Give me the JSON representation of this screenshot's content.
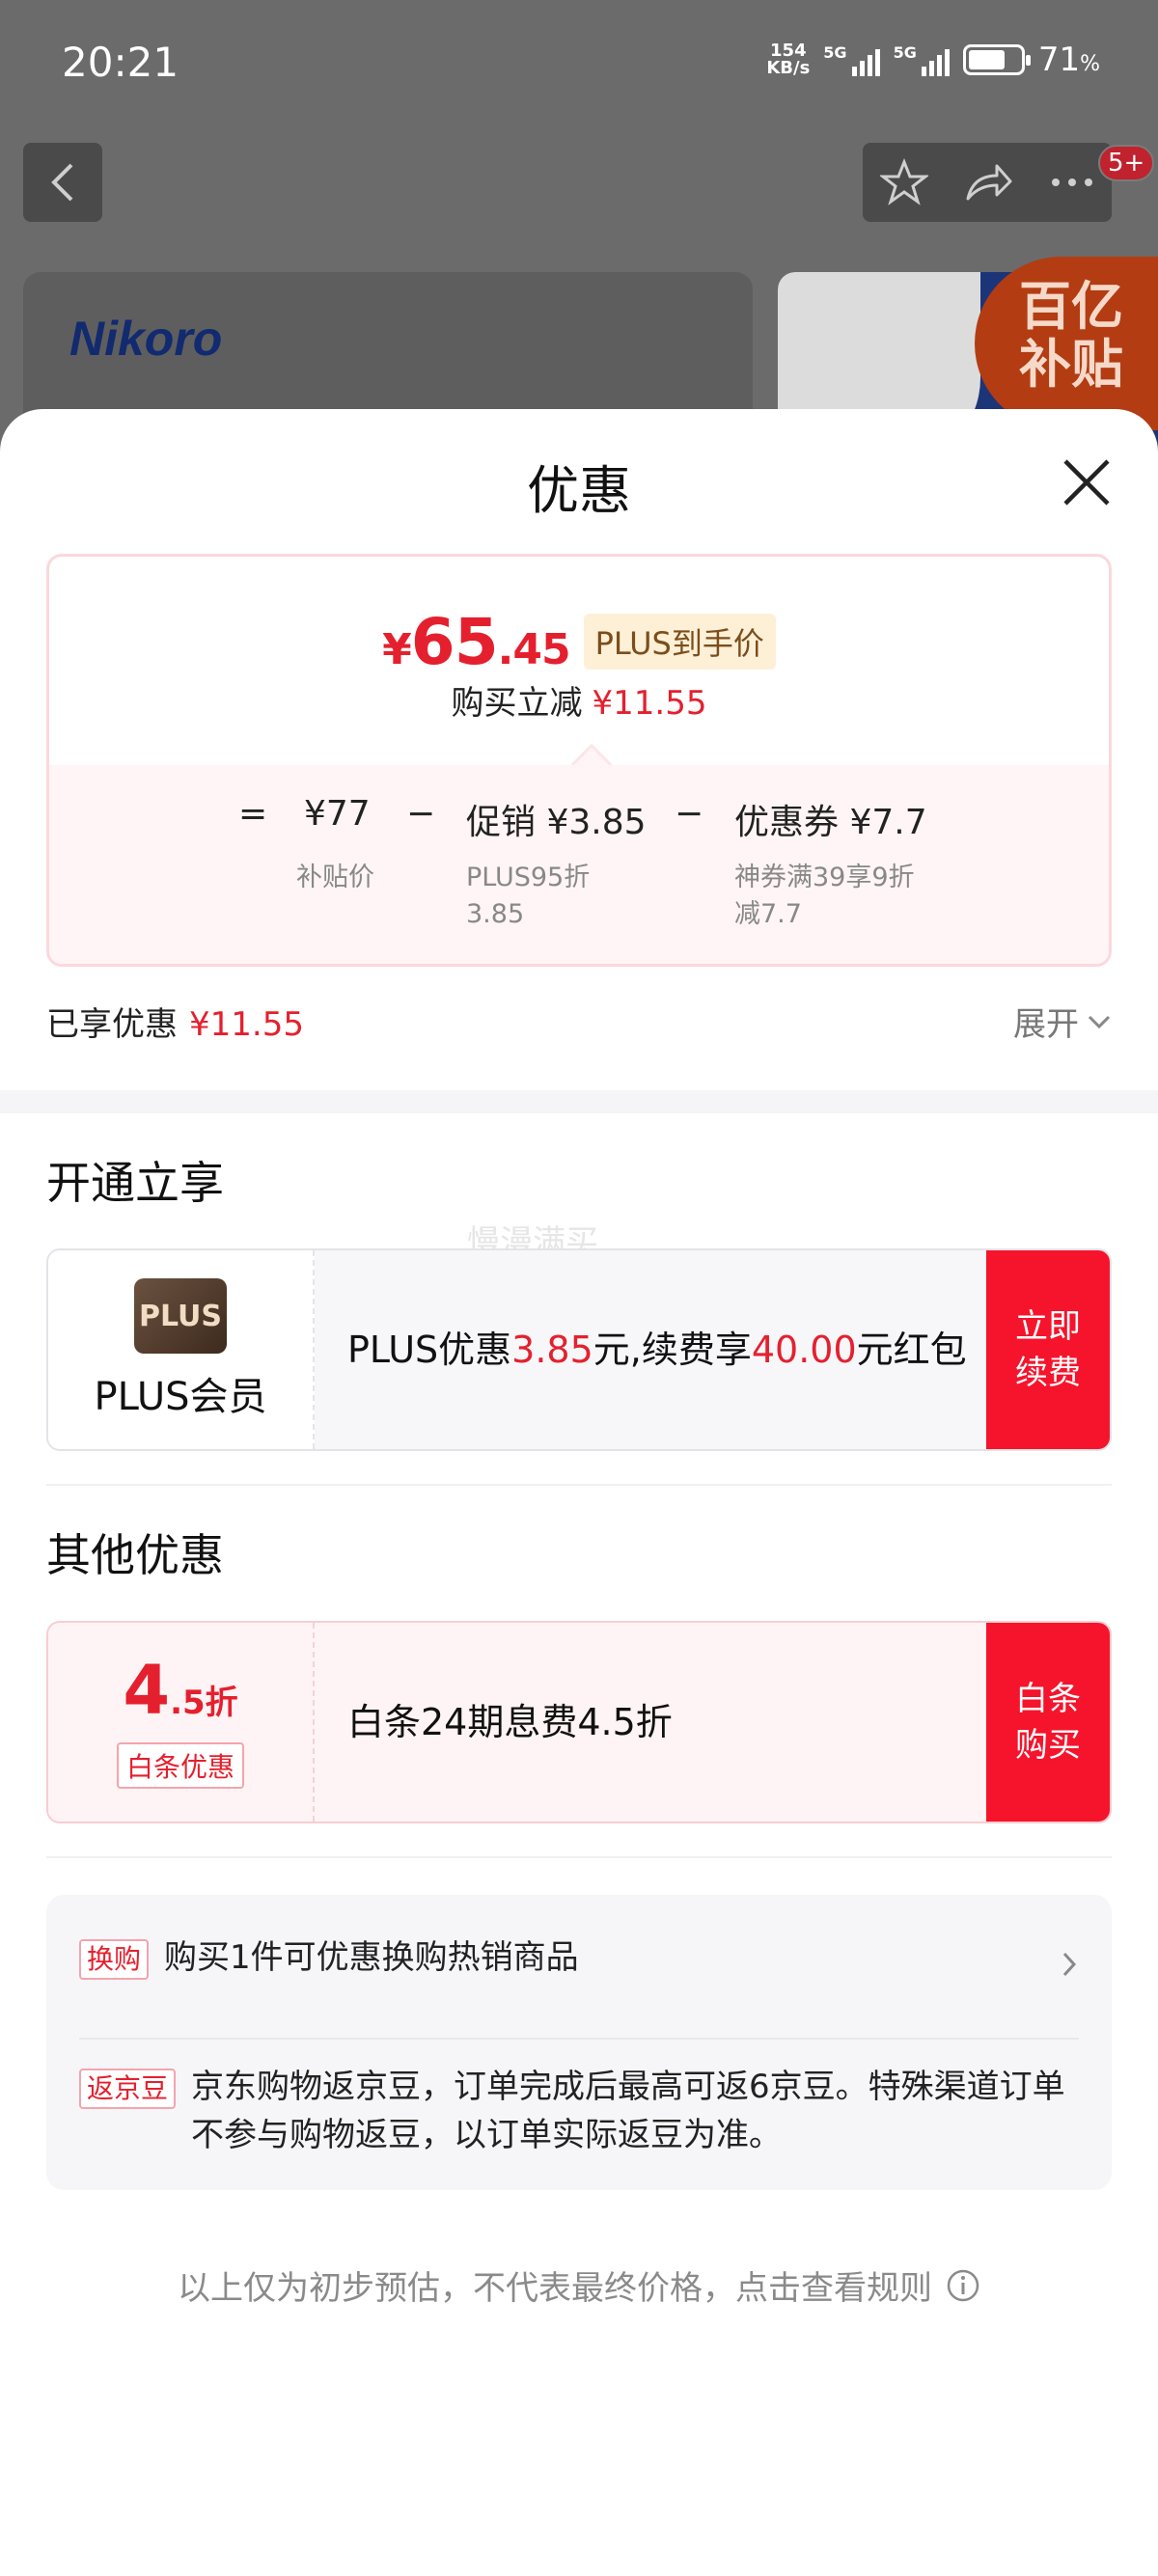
{
  "status_bar": {
    "time": "20:21",
    "net_speed_value": "154",
    "net_speed_unit": "KB/s",
    "sim1_label": "5G",
    "sim2_label": "5G",
    "battery_percent": "71",
    "battery_unit": "%",
    "battery_level": 0.71
  },
  "background": {
    "notification_badge": "5+",
    "brand_logo": "Nikoro",
    "subsidy_badge_line1": "百亿",
    "subsidy_badge_line2": "补贴"
  },
  "sheet": {
    "title": "优惠",
    "price_summary": {
      "yen": "¥",
      "price_int": "65",
      "price_dec": ".45",
      "price_tag": "PLUS到手价",
      "reduce_label": "购买立减",
      "reduce_amount": "¥11.55"
    },
    "breakdown": {
      "equals": "=",
      "minus": "−",
      "base_price": "¥77",
      "base_label": "补贴价",
      "promo_label": "促销",
      "promo_amount": "¥3.85",
      "promo_detail_line1": "PLUS95折",
      "promo_detail_line2": "3.85",
      "coupon_label": "优惠券",
      "coupon_amount": "¥7.7",
      "coupon_detail_line1": "神券满39享9折",
      "coupon_detail_line2": "减7.7"
    },
    "enjoyed": {
      "label": "已享优惠",
      "amount": "¥11.55",
      "expand_label": "展开"
    },
    "open_section": {
      "title": "开通立享",
      "watermark": "慢漫满买",
      "plus_logo_text": "PLUS",
      "plus_name": "PLUS会员",
      "text_prefix": "PLUS优惠",
      "amount1": "3.85",
      "text_middle": "元,续费享",
      "amount2": "40.00",
      "text_suffix": "元红包",
      "cta_line1": "立即",
      "cta_line2": "续费"
    },
    "other_section": {
      "title": "其他优惠",
      "discount_big": "4",
      "discount_small": ".5折",
      "discount_tag": "白条优惠",
      "text": "白条24期息费4.5折",
      "cta_line1": "白条",
      "cta_line2": "购买"
    },
    "info": {
      "exchange_tag": "换购",
      "exchange_text": "购买1件可优惠换购热销商品",
      "bean_tag": "返京豆",
      "bean_text": "京东购物返京豆，订单完成后最高可返6京豆。特殊渠道订单不参与购物返豆，以订单实际返豆为准。"
    },
    "footer_note": "以上仅为初步预估，不代表最终价格，点击查看规则"
  },
  "colors": {
    "accent_red": "#e5202e",
    "cta_red": "#f5142c",
    "plus_gold_bg": "#fdf0d6"
  }
}
